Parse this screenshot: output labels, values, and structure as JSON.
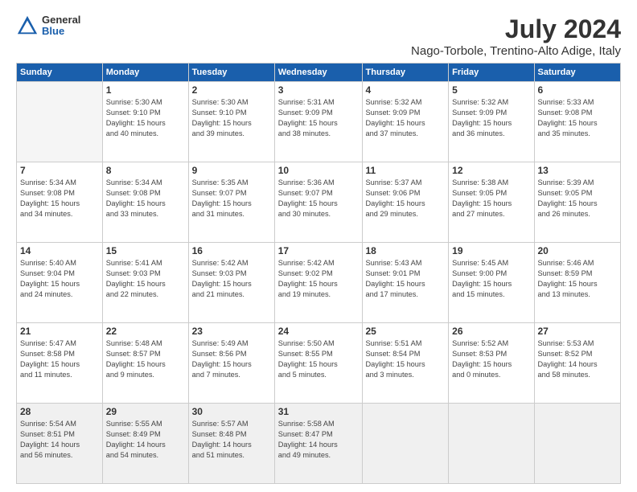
{
  "header": {
    "logo_general": "General",
    "logo_blue": "Blue",
    "title": "July 2024",
    "subtitle": "Nago-Torbole, Trentino-Alto Adige, Italy"
  },
  "columns": [
    "Sunday",
    "Monday",
    "Tuesday",
    "Wednesday",
    "Thursday",
    "Friday",
    "Saturday"
  ],
  "weeks": [
    [
      {
        "num": "",
        "info": ""
      },
      {
        "num": "1",
        "info": "Sunrise: 5:30 AM\nSunset: 9:10 PM\nDaylight: 15 hours\nand 40 minutes."
      },
      {
        "num": "2",
        "info": "Sunrise: 5:30 AM\nSunset: 9:10 PM\nDaylight: 15 hours\nand 39 minutes."
      },
      {
        "num": "3",
        "info": "Sunrise: 5:31 AM\nSunset: 9:09 PM\nDaylight: 15 hours\nand 38 minutes."
      },
      {
        "num": "4",
        "info": "Sunrise: 5:32 AM\nSunset: 9:09 PM\nDaylight: 15 hours\nand 37 minutes."
      },
      {
        "num": "5",
        "info": "Sunrise: 5:32 AM\nSunset: 9:09 PM\nDaylight: 15 hours\nand 36 minutes."
      },
      {
        "num": "6",
        "info": "Sunrise: 5:33 AM\nSunset: 9:08 PM\nDaylight: 15 hours\nand 35 minutes."
      }
    ],
    [
      {
        "num": "7",
        "info": "Sunrise: 5:34 AM\nSunset: 9:08 PM\nDaylight: 15 hours\nand 34 minutes."
      },
      {
        "num": "8",
        "info": "Sunrise: 5:34 AM\nSunset: 9:08 PM\nDaylight: 15 hours\nand 33 minutes."
      },
      {
        "num": "9",
        "info": "Sunrise: 5:35 AM\nSunset: 9:07 PM\nDaylight: 15 hours\nand 31 minutes."
      },
      {
        "num": "10",
        "info": "Sunrise: 5:36 AM\nSunset: 9:07 PM\nDaylight: 15 hours\nand 30 minutes."
      },
      {
        "num": "11",
        "info": "Sunrise: 5:37 AM\nSunset: 9:06 PM\nDaylight: 15 hours\nand 29 minutes."
      },
      {
        "num": "12",
        "info": "Sunrise: 5:38 AM\nSunset: 9:05 PM\nDaylight: 15 hours\nand 27 minutes."
      },
      {
        "num": "13",
        "info": "Sunrise: 5:39 AM\nSunset: 9:05 PM\nDaylight: 15 hours\nand 26 minutes."
      }
    ],
    [
      {
        "num": "14",
        "info": "Sunrise: 5:40 AM\nSunset: 9:04 PM\nDaylight: 15 hours\nand 24 minutes."
      },
      {
        "num": "15",
        "info": "Sunrise: 5:41 AM\nSunset: 9:03 PM\nDaylight: 15 hours\nand 22 minutes."
      },
      {
        "num": "16",
        "info": "Sunrise: 5:42 AM\nSunset: 9:03 PM\nDaylight: 15 hours\nand 21 minutes."
      },
      {
        "num": "17",
        "info": "Sunrise: 5:42 AM\nSunset: 9:02 PM\nDaylight: 15 hours\nand 19 minutes."
      },
      {
        "num": "18",
        "info": "Sunrise: 5:43 AM\nSunset: 9:01 PM\nDaylight: 15 hours\nand 17 minutes."
      },
      {
        "num": "19",
        "info": "Sunrise: 5:45 AM\nSunset: 9:00 PM\nDaylight: 15 hours\nand 15 minutes."
      },
      {
        "num": "20",
        "info": "Sunrise: 5:46 AM\nSunset: 8:59 PM\nDaylight: 15 hours\nand 13 minutes."
      }
    ],
    [
      {
        "num": "21",
        "info": "Sunrise: 5:47 AM\nSunset: 8:58 PM\nDaylight: 15 hours\nand 11 minutes."
      },
      {
        "num": "22",
        "info": "Sunrise: 5:48 AM\nSunset: 8:57 PM\nDaylight: 15 hours\nand 9 minutes."
      },
      {
        "num": "23",
        "info": "Sunrise: 5:49 AM\nSunset: 8:56 PM\nDaylight: 15 hours\nand 7 minutes."
      },
      {
        "num": "24",
        "info": "Sunrise: 5:50 AM\nSunset: 8:55 PM\nDaylight: 15 hours\nand 5 minutes."
      },
      {
        "num": "25",
        "info": "Sunrise: 5:51 AM\nSunset: 8:54 PM\nDaylight: 15 hours\nand 3 minutes."
      },
      {
        "num": "26",
        "info": "Sunrise: 5:52 AM\nSunset: 8:53 PM\nDaylight: 15 hours\nand 0 minutes."
      },
      {
        "num": "27",
        "info": "Sunrise: 5:53 AM\nSunset: 8:52 PM\nDaylight: 14 hours\nand 58 minutes."
      }
    ],
    [
      {
        "num": "28",
        "info": "Sunrise: 5:54 AM\nSunset: 8:51 PM\nDaylight: 14 hours\nand 56 minutes."
      },
      {
        "num": "29",
        "info": "Sunrise: 5:55 AM\nSunset: 8:49 PM\nDaylight: 14 hours\nand 54 minutes."
      },
      {
        "num": "30",
        "info": "Sunrise: 5:57 AM\nSunset: 8:48 PM\nDaylight: 14 hours\nand 51 minutes."
      },
      {
        "num": "31",
        "info": "Sunrise: 5:58 AM\nSunset: 8:47 PM\nDaylight: 14 hours\nand 49 minutes."
      },
      {
        "num": "",
        "info": ""
      },
      {
        "num": "",
        "info": ""
      },
      {
        "num": "",
        "info": ""
      }
    ]
  ]
}
